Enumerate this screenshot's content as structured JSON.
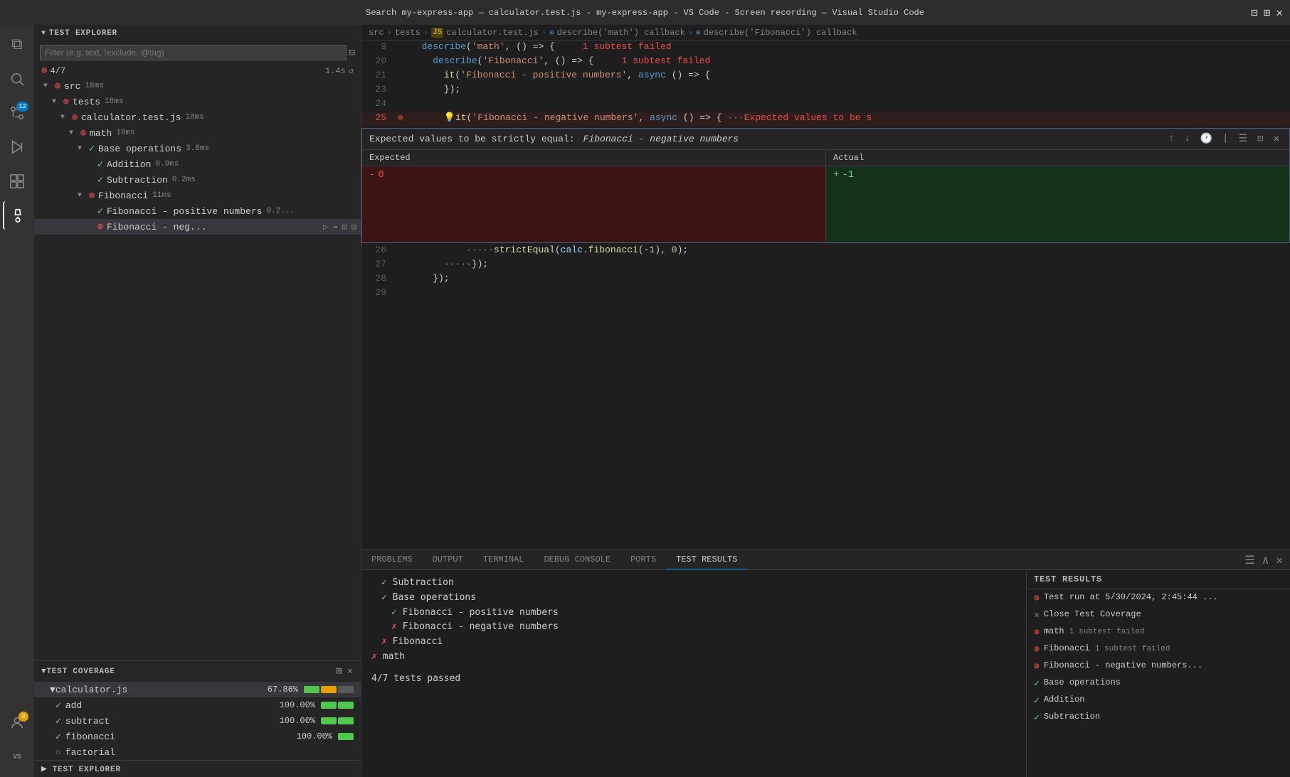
{
  "titlebar": {
    "text": "Search my-express-app — calculator.test.js - my-express-app - VS Code - Screen recording — Visual Studio Code"
  },
  "activity": {
    "icons": [
      {
        "name": "files-icon",
        "symbol": "⧉",
        "active": false
      },
      {
        "name": "search-icon",
        "symbol": "🔍",
        "active": false
      },
      {
        "name": "source-control-icon",
        "symbol": "⎇",
        "active": false,
        "badge": "12",
        "badge_color": "blue"
      },
      {
        "name": "run-icon",
        "symbol": "▷",
        "active": false
      },
      {
        "name": "extensions-icon",
        "symbol": "⊞",
        "active": false
      },
      {
        "name": "test-icon",
        "symbol": "⚗",
        "active": true
      },
      {
        "name": "accounts-icon",
        "symbol": "👤",
        "active": false,
        "badge": "3",
        "badge_color": "orange"
      }
    ],
    "bottom": [
      {
        "name": "accounts-bottom-icon",
        "symbol": "👤"
      },
      {
        "name": "settings-icon",
        "symbol": "⚙",
        "label": "VS"
      }
    ]
  },
  "sidebar": {
    "test_explorer": {
      "title": "TEST EXPLORER",
      "filter_placeholder": "Filter (e.g. text, !exclude, @tag)",
      "stats": "4/7",
      "time": "1.4s",
      "tree": [
        {
          "id": "src",
          "label": "src",
          "indent": 0,
          "status": "fail",
          "time": "18ms",
          "expanded": true,
          "chevron": "▼"
        },
        {
          "id": "tests",
          "label": "tests",
          "indent": 1,
          "status": "fail",
          "time": "18ms",
          "expanded": true,
          "chevron": "▼"
        },
        {
          "id": "calculator.test.js",
          "label": "calculator.test.js",
          "indent": 2,
          "status": "fail",
          "time": "18ms",
          "expanded": true,
          "chevron": "▼"
        },
        {
          "id": "math",
          "label": "math",
          "indent": 3,
          "status": "fail",
          "time": "18ms",
          "expanded": true,
          "chevron": "▼"
        },
        {
          "id": "base-ops",
          "label": "Base operations",
          "indent": 4,
          "status": "pass",
          "time": "3.8ms",
          "expanded": true,
          "chevron": "▼"
        },
        {
          "id": "addition",
          "label": "Addition",
          "indent": 5,
          "status": "pass",
          "time": "0.9ms",
          "expanded": false,
          "chevron": ""
        },
        {
          "id": "subtraction",
          "label": "Subtraction",
          "indent": 5,
          "status": "pass",
          "time": "0.2ms",
          "expanded": false,
          "chevron": ""
        },
        {
          "id": "fibonacci",
          "label": "Fibonacci",
          "indent": 4,
          "status": "fail",
          "time": "11ms",
          "expanded": true,
          "chevron": "▼"
        },
        {
          "id": "fib-pos",
          "label": "Fibonacci - positive numbers",
          "indent": 5,
          "status": "pass",
          "time": "0.2...",
          "expanded": false,
          "chevron": ""
        },
        {
          "id": "fib-neg",
          "label": "Fibonacci - neg...",
          "indent": 5,
          "status": "fail",
          "time": "",
          "has_actions": true
        }
      ]
    },
    "test_coverage": {
      "title": "TEST COVERAGE",
      "file": "calculator.js",
      "file_pct": "67.86%",
      "functions": [
        {
          "name": "add",
          "check": true,
          "pct": "100.00%"
        },
        {
          "name": "subtract",
          "check": true,
          "pct": "100.00%"
        },
        {
          "name": "fibonacci",
          "check": true,
          "pct": "100.00%"
        },
        {
          "name": "factorial",
          "check": false,
          "pct": ""
        }
      ]
    },
    "bottom_label": "TEST EXPLORER"
  },
  "breadcrumb": {
    "parts": [
      "src",
      ">",
      "tests",
      ">",
      "calculator.test.js",
      ">",
      "describe('math') callback",
      ">",
      "describe('Fibonacci') callback"
    ]
  },
  "editor": {
    "lines": [
      {
        "num": 9,
        "content": "  describe('math', () => {",
        "annotation": "  1 subtest failed",
        "ann_color": "#f14c4c"
      },
      {
        "num": 20,
        "content": "    describe('Fibonacci', () => {",
        "annotation": "  1 subtest failed",
        "ann_color": "#f14c4c"
      },
      {
        "num": 21,
        "content": "      it('Fibonacci - positive numbers', async () => {",
        "annotation": "",
        "ann_color": ""
      },
      {
        "num": 23,
        "content": "      });",
        "annotation": "",
        "ann_color": ""
      },
      {
        "num": 24,
        "content": "",
        "annotation": "",
        "ann_color": ""
      },
      {
        "num": 25,
        "content": "      it('Fibonacci - negative numbers', async () => { ···Expected values to be s",
        "annotation": "",
        "ann_color": "",
        "has_error": true
      },
      {
        "num": 26,
        "content": "          strictEqual(calc.fibonacci(-1), 0);",
        "annotation": "",
        "ann_color": ""
      },
      {
        "num": 27,
        "content": "      });",
        "annotation": "",
        "ann_color": ""
      },
      {
        "num": 28,
        "content": "    });",
        "annotation": "",
        "ann_color": ""
      },
      {
        "num": 29,
        "content": "",
        "annotation": "",
        "ann_color": ""
      }
    ],
    "diff_header": {
      "label": "Expected values to be strictly equal:",
      "test_name": "Fibonacci - negative numbers",
      "close_label": "✕"
    },
    "diff": {
      "expected_header": "Expected",
      "actual_header": "Actual",
      "expected_value": "0",
      "actual_value": "-1"
    }
  },
  "bottom_panel": {
    "tabs": [
      "PROBLEMS",
      "OUTPUT",
      "TERMINAL",
      "DEBUG CONSOLE",
      "PORTS",
      "TEST RESULTS"
    ],
    "active_tab": "TEST RESULTS",
    "output": {
      "lines": [
        {
          "indent": 1,
          "icon": "pass",
          "text": "Subtraction"
        },
        {
          "indent": 1,
          "icon": "pass",
          "text": "Base operations"
        },
        {
          "indent": 2,
          "icon": "pass",
          "text": "Fibonacci - positive numbers"
        },
        {
          "indent": 2,
          "icon": "fail",
          "text": "Fibonacci - negative numbers"
        },
        {
          "indent": 1,
          "icon": "fail",
          "text": "Fibonacci"
        },
        {
          "indent": 0,
          "icon": "fail",
          "text": "math"
        },
        {
          "indent": 0,
          "icon": "",
          "text": ""
        },
        {
          "indent": 0,
          "icon": "",
          "text": "4/7 tests passed",
          "summary": true
        }
      ]
    },
    "results": {
      "header": "TEST RESULTS",
      "items": [
        {
          "icon": "fail-circle",
          "text": "Test run at 5/30/2024, 2:45:44 ...",
          "sub": ""
        },
        {
          "icon": "x",
          "text": "Close Test Coverage",
          "sub": ""
        },
        {
          "icon": "fail-circle",
          "text": "math",
          "sub": "1 subtest failed"
        },
        {
          "icon": "fail-circle",
          "text": "Fibonacci",
          "sub": "1 subtest failed"
        },
        {
          "icon": "fail-circle",
          "text": "Fibonacci - negative numbers...",
          "sub": ""
        },
        {
          "icon": "pass-circle",
          "text": "Base operations",
          "sub": ""
        },
        {
          "icon": "pass-circle",
          "text": "Addition",
          "sub": ""
        },
        {
          "icon": "pass-circle",
          "text": "Subtraction",
          "sub": ""
        }
      ]
    }
  }
}
